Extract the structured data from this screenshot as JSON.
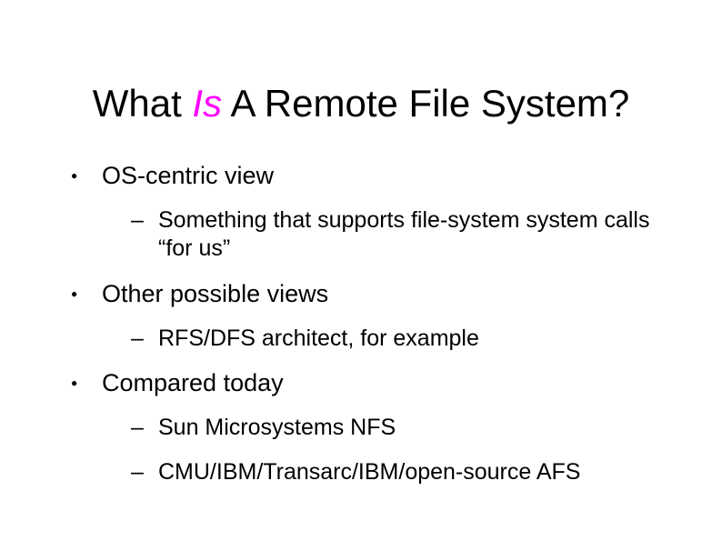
{
  "slide": {
    "title_part1": "What ",
    "title_emph": "Is",
    "title_part2": " A Remote File System?",
    "bullets": [
      {
        "text": "OS-centric view",
        "children": [
          {
            "text": "Something that supports file-system system calls “for us”"
          }
        ]
      },
      {
        "text": "Other possible views",
        "children": [
          {
            "text": "RFS/DFS architect, for example"
          }
        ]
      },
      {
        "text": "Compared today",
        "children": [
          {
            "text": "Sun Microsystems NFS"
          },
          {
            "text": "CMU/IBM/Transarc/IBM/open-source AFS"
          }
        ]
      }
    ]
  }
}
